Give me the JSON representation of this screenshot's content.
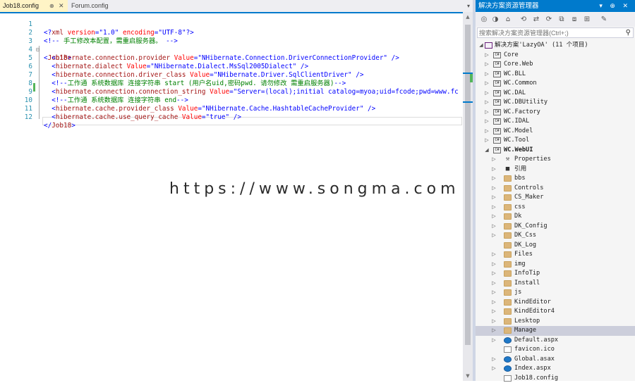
{
  "tabs": {
    "active": "Job18.config",
    "active_pin": "⊕",
    "active_close": "✕",
    "inactive": "Forum.config",
    "dropdown": "▾"
  },
  "editor": {
    "line_numbers": [
      "1",
      "2",
      "3",
      "4",
      "5",
      "6",
      "7",
      "8",
      "9",
      "10",
      "11",
      "12"
    ],
    "fold_marker": "⊟",
    "lines": {
      "l1": {
        "a": "<?",
        "b": "xml",
        "c": " version",
        "d": "=",
        "e": "\"1.0\"",
        "f": " encoding",
        "g": "=",
        "h": "\"UTF-8\"",
        "i": "?>"
      },
      "l2": {
        "a": "<!--",
        "b": " 手工修改本配置，需重启服务器。",
        "c": "-->"
      },
      "l3": {
        "a": "<",
        "b": "Job18",
        "c": ">"
      },
      "l4": {
        "a": "<",
        "b": "hibernate.connection.provider",
        "c": " Value",
        "d": "=",
        "e": "\"NHibernate.Connection.DriverConnectionProvider\"",
        "f": " />"
      },
      "l5": {
        "a": "<",
        "b": "hibernate.dialect",
        "c": " Value",
        "d": "=",
        "e": "\"NHibernate.Dialect.MsSql2005Dialect\"",
        "f": " />"
      },
      "l6": {
        "a": "<",
        "b": "hibernate.connection.driver_class",
        "c": " Value",
        "d": "=",
        "e": "\"NHibernate.Driver.SqlClientDriver\"",
        "f": " />"
      },
      "l7": {
        "a": "<!--",
        "b": "工作通 系统数据库 连接字符串 start (用户名uid,密码pwd. 请勿修改 需重启服务器)",
        "c": "-->"
      },
      "l8": {
        "a": "<",
        "b": "hibernate.connection.connection_string",
        "c": " Value",
        "d": "=",
        "e": "\"Server=(local);initial catalog=myoa;uid=fcode;pwd=www.fc"
      },
      "l9": {
        "a": "<!--",
        "b": "工作通 系统数据库 连接字符串 end",
        "c": "-->"
      },
      "l10": {
        "a": "<",
        "b": "hibernate.cache.provider_class",
        "c": " Value",
        "d": "=",
        "e": "\"NHibernate.Cache.HashtableCacheProvider\"",
        "f": " />"
      },
      "l11": {
        "a": "<",
        "b": "hibernate.cache.use_query_cache",
        "c": " Value",
        "d": "=",
        "e": "\"true\"",
        "f": " />"
      },
      "l12": {
        "a": "</",
        "b": "Job18",
        "c": ">"
      }
    }
  },
  "solution_explorer": {
    "title": "解决方案资源管理器",
    "title_buttons": "▾ ⊕ ✕",
    "toolbar_icons": [
      "◎",
      "◑",
      "⌂",
      "⟲",
      "⇄",
      "⟳",
      "⧉",
      "⧈",
      "⊞",
      "✎"
    ],
    "search_placeholder": "搜索解决方案资源管理器(Ctrl+;)",
    "search_icon": "⚲",
    "expand_open": "◢",
    "expand_closed": "▷",
    "solution_label": "解决方案'LazyOA' (11 个项目)",
    "projects": [
      "Core",
      "Core.Web",
      "WC.BLL",
      "WC.Common",
      "WC.DAL",
      "WC.DBUtility",
      "WC.Factory",
      "WC.IDAL",
      "WC.Model",
      "WC.Tool",
      "WC.WebUI"
    ],
    "project_icon_text": "C#",
    "webui_children": [
      "Properties",
      "引用",
      "bbs",
      "Controls",
      "CS_Maker",
      "css",
      "Dk",
      "DK_Config",
      "DK_Css",
      "DK_Log",
      "Files",
      "img",
      "InfoTip",
      "Install",
      "js",
      "KindEditor",
      "KindEditor4",
      "Lesktop",
      "Manage",
      "Default.aspx",
      "favicon.ico",
      "Global.asax",
      "Index.aspx",
      "Job18.config"
    ],
    "selected_item": "Manage"
  },
  "watermark": "https://www.songma.com"
}
